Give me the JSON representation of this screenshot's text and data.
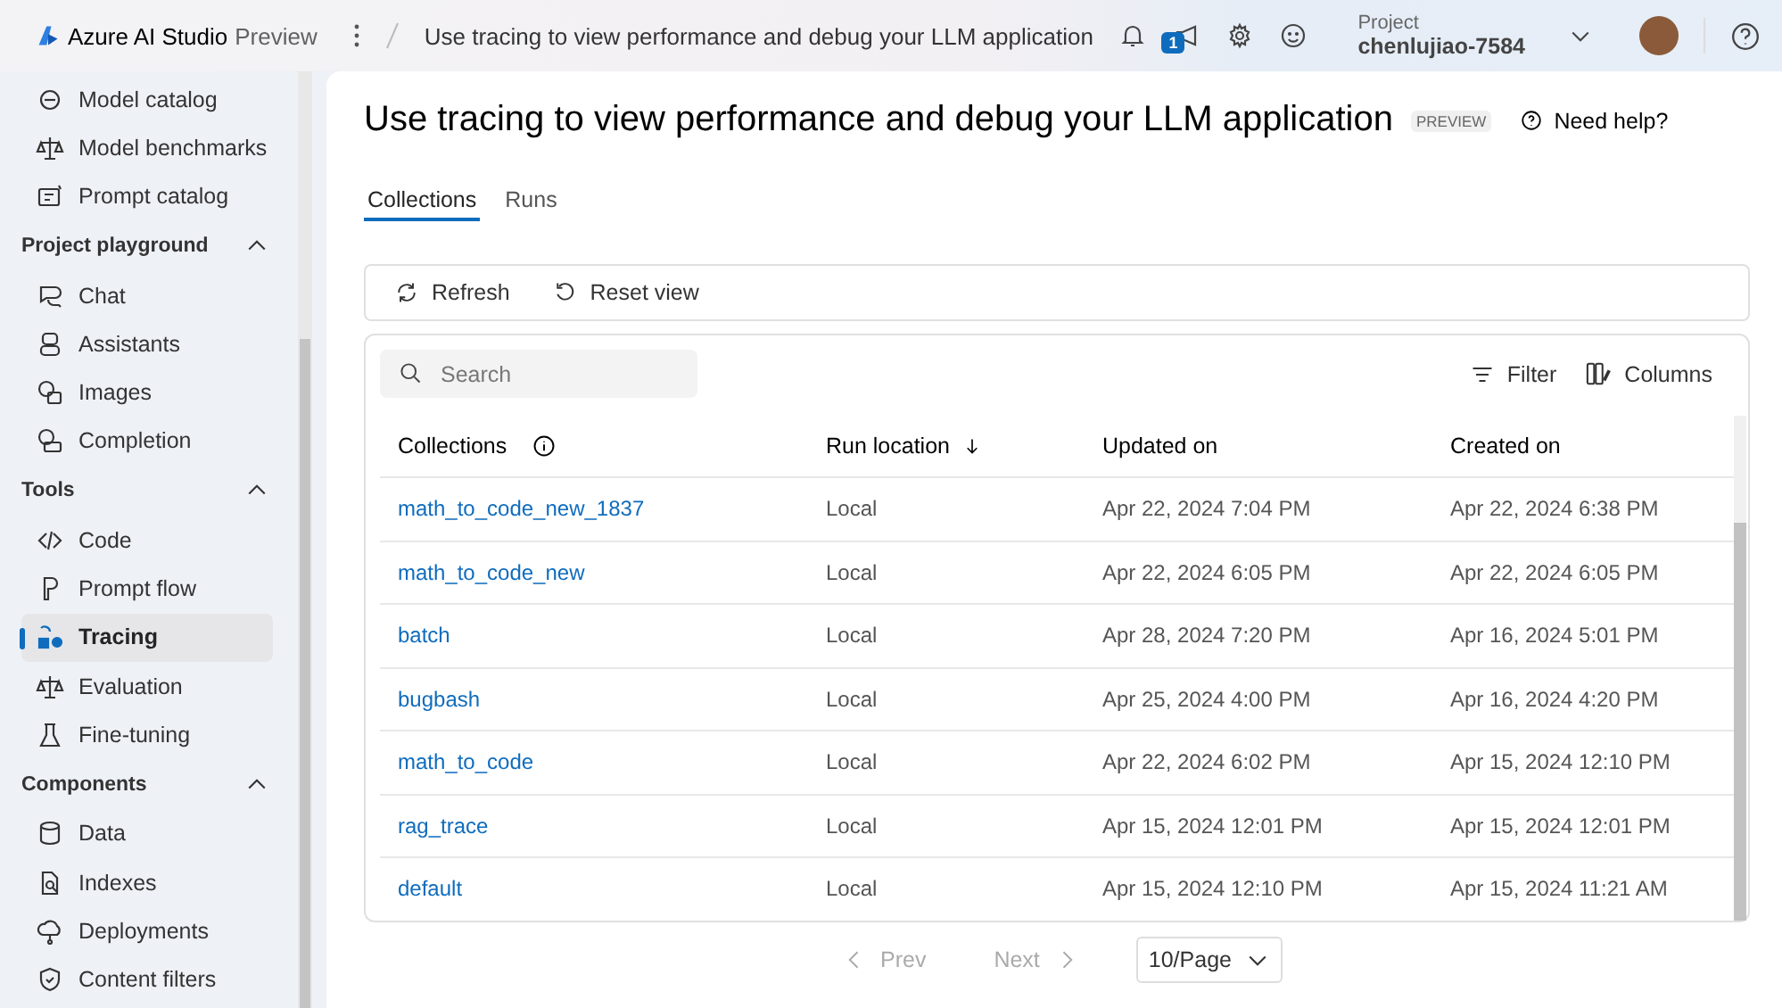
{
  "header": {
    "brand": "Azure AI Studio",
    "brand_suffix": "Preview",
    "breadcrumb": "Use tracing to view performance and debug your LLM application",
    "notification_count": "1",
    "project_label": "Project",
    "project_name": "chenlujiao-7584"
  },
  "sidebar": {
    "top_items": [
      {
        "label": "Model catalog",
        "selected": false
      },
      {
        "label": "Model benchmarks",
        "selected": false
      },
      {
        "label": "Prompt catalog",
        "selected": false
      }
    ],
    "sections": [
      {
        "title": "Project playground",
        "expanded": true,
        "items": [
          {
            "label": "Chat",
            "selected": false
          },
          {
            "label": "Assistants",
            "selected": false
          },
          {
            "label": "Images",
            "selected": false
          },
          {
            "label": "Completion",
            "selected": false
          }
        ]
      },
      {
        "title": "Tools",
        "expanded": true,
        "items": [
          {
            "label": "Code",
            "selected": false
          },
          {
            "label": "Prompt flow",
            "selected": false
          },
          {
            "label": "Tracing",
            "selected": true
          },
          {
            "label": "Evaluation",
            "selected": false
          },
          {
            "label": "Fine-tuning",
            "selected": false
          }
        ]
      },
      {
        "title": "Components",
        "expanded": true,
        "items": [
          {
            "label": "Data",
            "selected": false
          },
          {
            "label": "Indexes",
            "selected": false
          },
          {
            "label": "Deployments",
            "selected": false
          },
          {
            "label": "Content filters",
            "selected": false
          }
        ]
      }
    ]
  },
  "page": {
    "title": "Use tracing to view performance and debug your LLM application",
    "badge": "PREVIEW",
    "help": "Need help?"
  },
  "tabs": [
    {
      "label": "Collections",
      "selected": true
    },
    {
      "label": "Runs",
      "selected": false
    }
  ],
  "toolbar": [
    "Refresh",
    "Reset view"
  ],
  "table": {
    "search": {
      "placeholder": "Search"
    },
    "filter": "Filter",
    "columns_button": "Columns",
    "columns": [
      {
        "label": "Collections",
        "info": true,
        "sorted": false
      },
      {
        "label": "Run location",
        "info": false,
        "sorted": true
      },
      {
        "label": "Updated on",
        "info": false,
        "sorted": false
      },
      {
        "label": "Created on",
        "info": false,
        "sorted": false
      }
    ],
    "rows": [
      [
        "math_to_code_new_1837",
        "Local",
        "Apr 22, 2024 7:04 PM",
        "Apr 22, 2024 6:38 PM"
      ],
      [
        "math_to_code_new",
        "Local",
        "Apr 22, 2024 6:05 PM",
        "Apr 22, 2024 6:05 PM"
      ],
      [
        "batch",
        "Local",
        "Apr 28, 2024 7:20 PM",
        "Apr 16, 2024 5:01 PM"
      ],
      [
        "bugbash",
        "Local",
        "Apr 25, 2024 4:00 PM",
        "Apr 16, 2024 4:20 PM"
      ],
      [
        "math_to_code",
        "Local",
        "Apr 22, 2024 6:02 PM",
        "Apr 15, 2024 12:10 PM"
      ],
      [
        "rag_trace",
        "Local",
        "Apr 15, 2024 12:01 PM",
        "Apr 15, 2024 12:01 PM"
      ],
      [
        "default",
        "Local",
        "Apr 15, 2024 12:10 PM",
        "Apr 15, 2024 11:21 AM"
      ]
    ]
  },
  "pagination": {
    "prev": {
      "label": "Prev",
      "disabled": true
    },
    "next": {
      "label": "Next",
      "disabled": true
    },
    "page_size": "10/Page"
  }
}
